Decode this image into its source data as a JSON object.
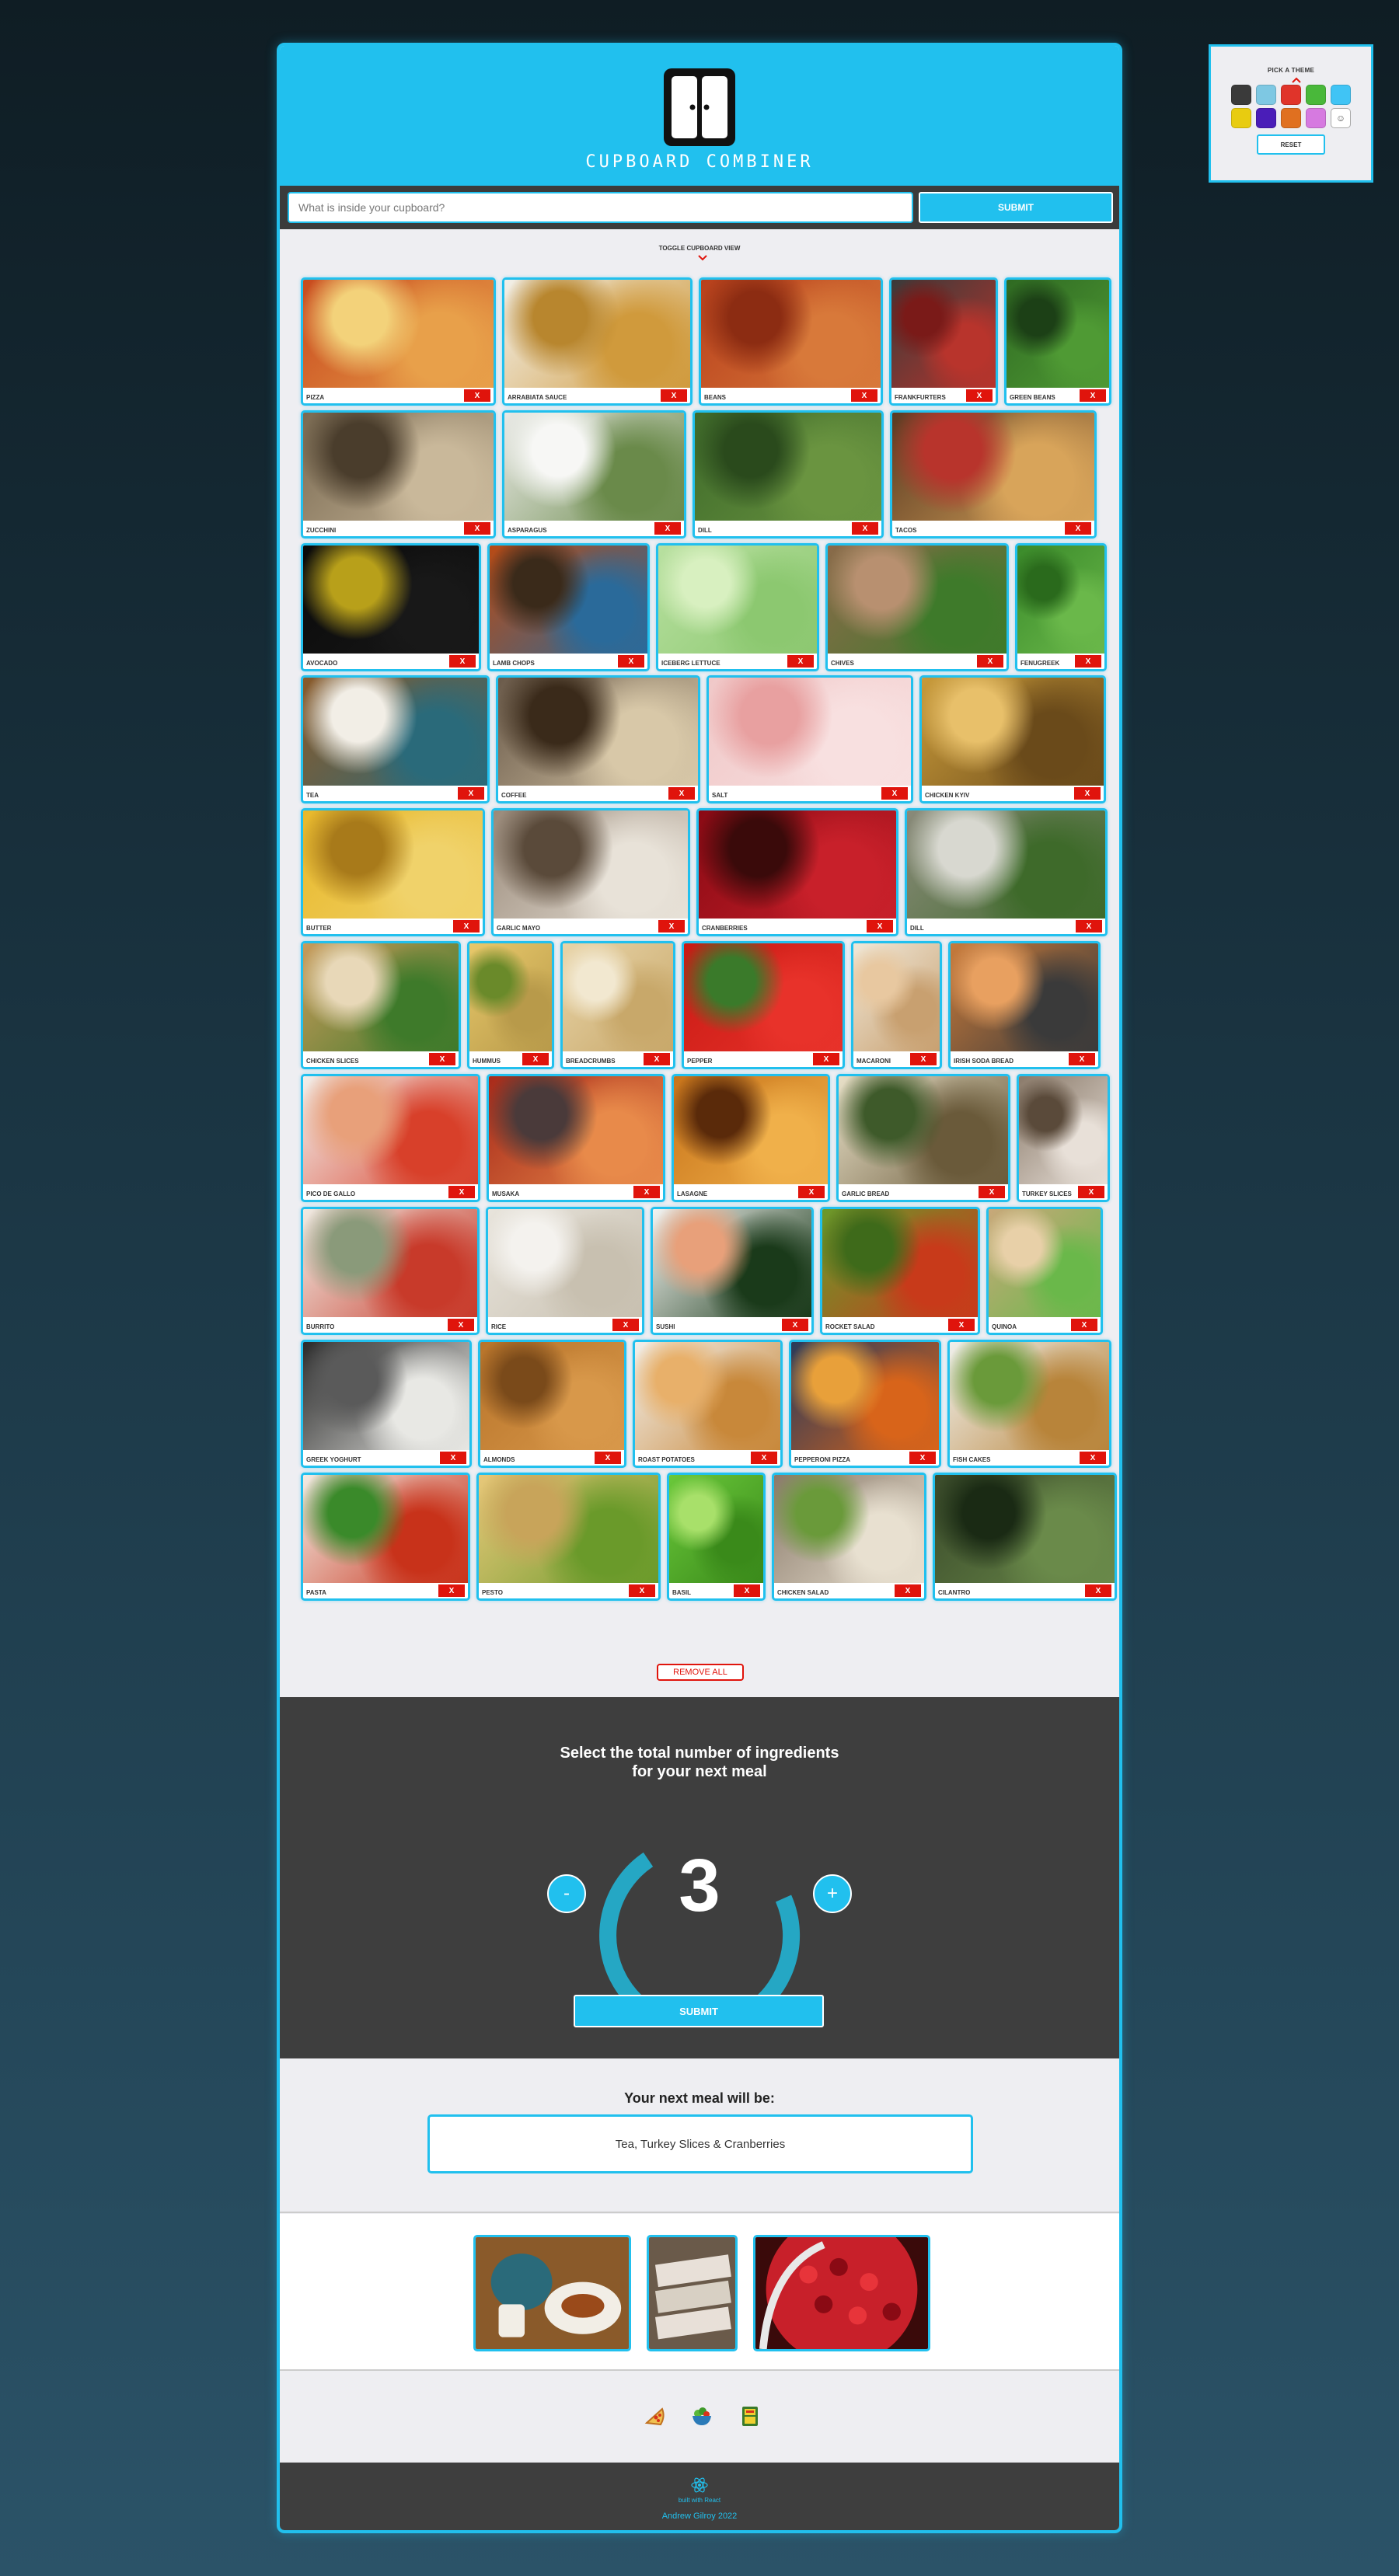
{
  "theme_picker": {
    "title": "PICK A THEME",
    "swatches": [
      "#3a3a3a",
      "#7ec8e3",
      "#e0342a",
      "#49b83a",
      "#40c4f5",
      "#e8cc10",
      "#4a1db8",
      "#e07020",
      "#d67ae0",
      "custom"
    ],
    "reset_label": "RESET"
  },
  "header": {
    "logo_text": "CUPBOARD COMBINER"
  },
  "search": {
    "placeholder": "What is inside your cupboard?",
    "submit_label": "SUBMIT"
  },
  "toggle_label": "TOGGLE CUPBOARD VIEW",
  "remove_label": "X",
  "ingredients": [
    {
      "label": "PIZZA",
      "colors": [
        "#c84a1e",
        "#e8a04a",
        "#f3d27a"
      ]
    },
    {
      "label": "ARRABIATA SAUCE",
      "colors": [
        "#f2f0ea",
        "#d09a3c",
        "#b8862e"
      ]
    },
    {
      "label": "BEANS",
      "colors": [
        "#b8401c",
        "#d8793a",
        "#8c2c12"
      ]
    },
    {
      "label": "FRANKFURTERS",
      "colors": [
        "#3a3a3a",
        "#b8342c",
        "#7a1a18"
      ]
    },
    {
      "label": "GREEN BEANS",
      "colors": [
        "#2f6a22",
        "#4f9a34",
        "#1c4016"
      ]
    },
    {
      "label": "ZUCCHINI",
      "colors": [
        "#7a6a52",
        "#c9b89a",
        "#4a3d2c"
      ]
    },
    {
      "label": "ASPARAGUS",
      "colors": [
        "#e9e9e6",
        "#6a8a4a",
        "#f7f7f5"
      ]
    },
    {
      "label": "DILL",
      "colors": [
        "#3e6a2a",
        "#6a9440",
        "#2a4a1c"
      ]
    },
    {
      "label": "TACOS",
      "colors": [
        "#5a3a22",
        "#d8a45a",
        "#b8342c"
      ]
    },
    {
      "label": "AVOCADO",
      "colors": [
        "#0a0a0a",
        "#181818",
        "#b8a01a"
      ]
    },
    {
      "label": "LAMB CHOPS",
      "colors": [
        "#b84a14",
        "#2a6a9a",
        "#3a2a1a"
      ]
    },
    {
      "label": "ICEBERG LETTUCE",
      "colors": [
        "#b8e0a0",
        "#8cc870",
        "#d8f0c0"
      ]
    },
    {
      "label": "CHIVES",
      "colors": [
        "#8a6a4a",
        "#3e7a2a",
        "#b89070"
      ]
    },
    {
      "label": "FENUGREEK",
      "colors": [
        "#3a8a2a",
        "#6ab84a",
        "#2a6a1c"
      ]
    },
    {
      "label": "TEA",
      "colors": [
        "#8a5a2a",
        "#2a6a7a",
        "#f2eee6"
      ]
    },
    {
      "label": "COFFEE",
      "colors": [
        "#6a5a4a",
        "#d8c8a8",
        "#3a2a1a"
      ]
    },
    {
      "label": "SALT",
      "colors": [
        "#f0c8c8",
        "#f8e0e0",
        "#e8a0a0"
      ]
    },
    {
      "label": "CHICKEN KYIV",
      "colors": [
        "#c89a3a",
        "#6a4a1a",
        "#e8c06a"
      ]
    },
    {
      "label": "BUTTER",
      "colors": [
        "#e8b82a",
        "#f0d26a",
        "#a87a1a"
      ]
    },
    {
      "label": "GARLIC MAYO",
      "colors": [
        "#9a8a7a",
        "#e8e2d8",
        "#5a4a3a"
      ]
    },
    {
      "label": "CRANBERRIES",
      "colors": [
        "#8a0a14",
        "#c8202a",
        "#3a0a0a"
      ]
    },
    {
      "label": "DILL",
      "colors": [
        "#8a8a7a",
        "#3e6a2a",
        "#d8d8d0"
      ]
    },
    {
      "label": "CHICKEN SLICES",
      "colors": [
        "#c89a5a",
        "#3e7a2a",
        "#e8d8b8"
      ]
    },
    {
      "label": "HUMMUS",
      "colors": [
        "#e8c86a",
        "#b89a4a",
        "#6a8a2a"
      ]
    },
    {
      "label": "BREADCRUMBS",
      "colors": [
        "#e8d4a8",
        "#c8a86a",
        "#f2e8d0"
      ]
    },
    {
      "label": "PEPPER",
      "colors": [
        "#c81a14",
        "#e8322a",
        "#3a7a2a"
      ]
    },
    {
      "label": "MACARONI",
      "colors": [
        "#f0e8d8",
        "#c8a070",
        "#e8c8a0"
      ]
    },
    {
      "label": "IRISH SODA BREAD",
      "colors": [
        "#c87a3a",
        "#3a3a3a",
        "#e8a060"
      ]
    },
    {
      "label": "PICO DE GALLO",
      "colors": [
        "#f2f0ec",
        "#d8402a",
        "#e8a07a"
      ]
    },
    {
      "label": "MUSAKA",
      "colors": [
        "#a82a1a",
        "#e88a4a",
        "#4a3a3a"
      ]
    },
    {
      "label": "LASAGNE",
      "colors": [
        "#c8741a",
        "#f0b04a",
        "#5a2a0a"
      ]
    },
    {
      "label": "GARLIC BREAD",
      "colors": [
        "#e8e0c8",
        "#6a5a3a",
        "#3e5a2a"
      ]
    },
    {
      "label": "TURKEY SLICES",
      "colors": [
        "#8a7a6a",
        "#e8e0d8",
        "#5a4a3a"
      ]
    },
    {
      "label": "BURRITO",
      "colors": [
        "#f0ece4",
        "#c83a2a",
        "#8a9a7a"
      ]
    },
    {
      "label": "RICE",
      "colors": [
        "#e8e4dc",
        "#c8c0b0",
        "#f4f2ee"
      ]
    },
    {
      "label": "SUSHI",
      "colors": [
        "#f4f4f2",
        "#1a3a1a",
        "#e8a07a"
      ]
    },
    {
      "label": "ROCKET SALAD",
      "colors": [
        "#6a9a2a",
        "#c83a1a",
        "#3e6a1a"
      ]
    },
    {
      "label": "QUINOA",
      "colors": [
        "#c8a87a",
        "#6ab84a",
        "#e8d0a8"
      ]
    },
    {
      "label": "GREEK YOGHURT",
      "colors": [
        "#2a2a2a",
        "#e8e8e4",
        "#5a5a5a"
      ]
    },
    {
      "label": "ALMONDS",
      "colors": [
        "#b8742a",
        "#d8984a",
        "#7a4a1a"
      ]
    },
    {
      "label": "ROAST POTATOES",
      "colors": [
        "#f2f0ec",
        "#c8883a",
        "#e8b06a"
      ]
    },
    {
      "label": "PEPPERONI PIZZA",
      "colors": [
        "#2a3a5a",
        "#d8641a",
        "#e8a03a"
      ]
    },
    {
      "label": "FISH CAKES",
      "colors": [
        "#f0f0ec",
        "#b8843a",
        "#6a9a3a"
      ]
    },
    {
      "label": "PASTA",
      "colors": [
        "#f2ece4",
        "#c8321a",
        "#3a8a2a"
      ]
    },
    {
      "label": "PESTO",
      "colors": [
        "#e8c87a",
        "#6a9a2a",
        "#c8a45a"
      ]
    },
    {
      "label": "BASIL",
      "colors": [
        "#6ac83a",
        "#3a8a1a",
        "#a8e06a"
      ]
    },
    {
      "label": "CHICKEN SALAD",
      "colors": [
        "#8a7a6a",
        "#e8e0d0",
        "#6a9a3a"
      ]
    },
    {
      "label": "CILANTRO",
      "colors": [
        "#3a4a2a",
        "#6a8a4a",
        "#1a2a14"
      ]
    }
  ],
  "remove_all_label": "REMOVE ALL",
  "counter": {
    "title_line1": "Select the total number of ingredients",
    "title_line2": "for your next meal",
    "value": 3,
    "minus_label": "-",
    "plus_label": "+",
    "submit_label": "SUBMIT"
  },
  "result": {
    "title": "Your next meal will be:",
    "meal": "Tea, Turkey Slices & Cranberries",
    "images": [
      "tea",
      "turkey-slices",
      "cranberries"
    ]
  },
  "footer_icons": [
    "pizza-icon",
    "salad-bowl-icon",
    "cupboard-icon"
  ],
  "footer": {
    "built_with": "built with React",
    "author": "Andrew Gilroy 2022"
  }
}
